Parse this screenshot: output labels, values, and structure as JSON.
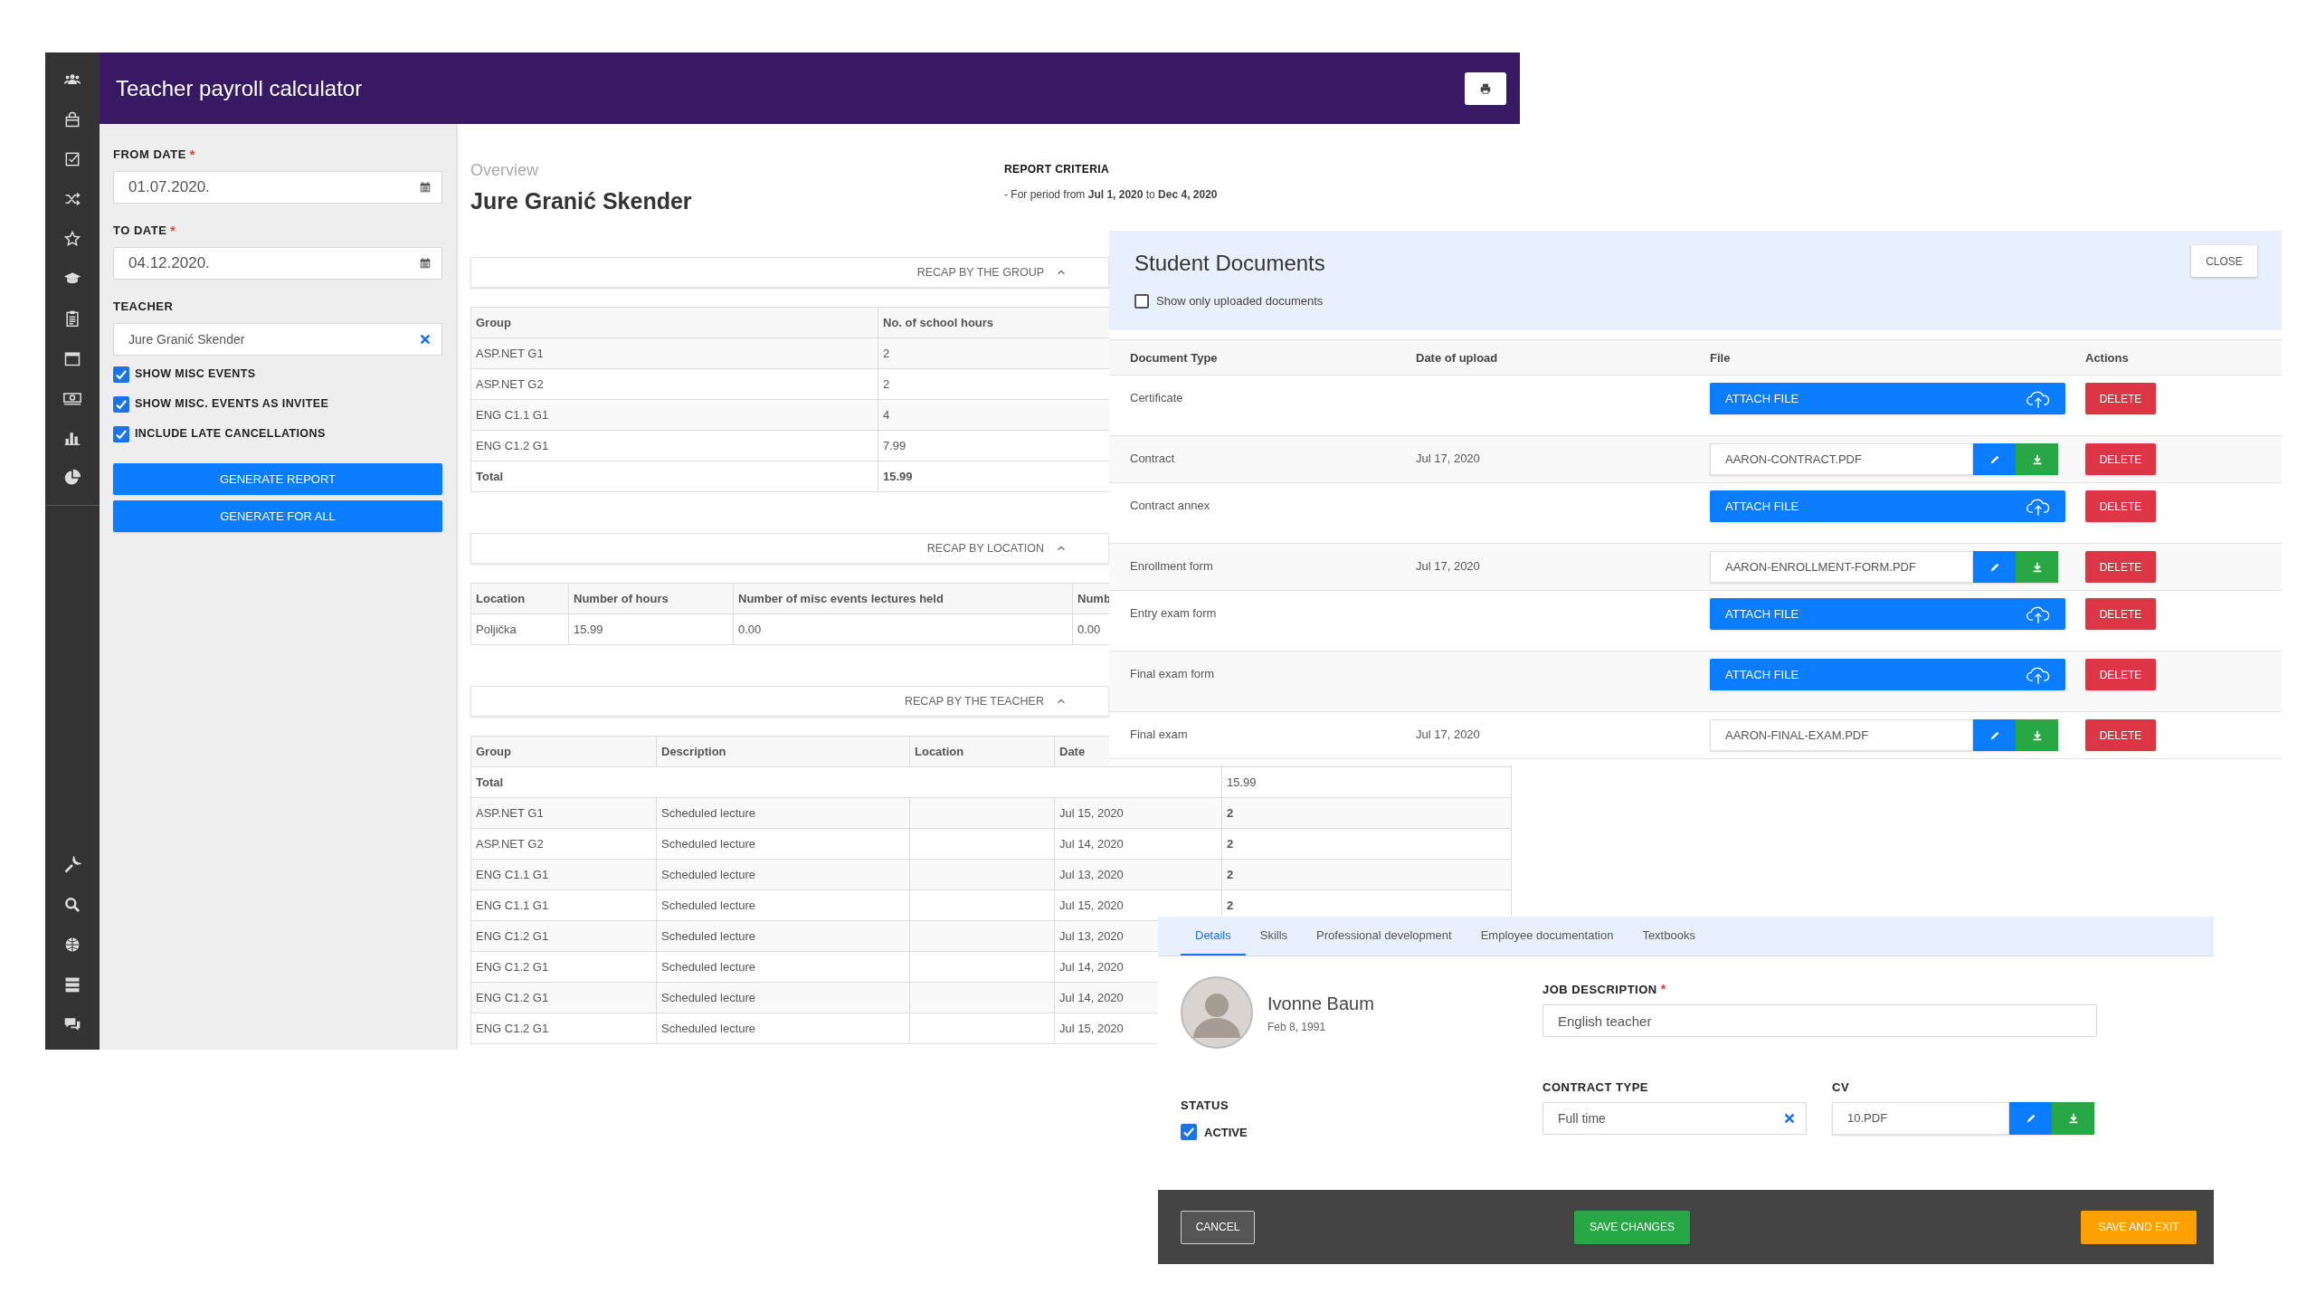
{
  "payroll_window": {
    "title": "Teacher payroll calculator",
    "form": {
      "from_date": {
        "label": "FROM DATE",
        "required_mark": "*",
        "value": "01.07.2020."
      },
      "to_date": {
        "label": "TO DATE",
        "required_mark": "*",
        "value": "04.12.2020."
      },
      "teacher": {
        "label": "TEACHER",
        "value": "Jure Granić Skender"
      },
      "options": [
        {
          "label": "SHOW MISC EVENTS",
          "checked": true
        },
        {
          "label": "SHOW MISC. EVENTS AS INVITEE",
          "checked": true
        },
        {
          "label": "INCLUDE LATE CANCELLATIONS",
          "checked": true
        }
      ],
      "buttons": [
        "GENERATE REPORT",
        "GENERATE FOR ALL"
      ]
    },
    "overview": {
      "subtitle": "Overview",
      "name": "Jure Granić Skender"
    },
    "report_criteria": {
      "title": "REPORT CRITERIA",
      "text": "- For period from **Jul 1, 2020** to **Dec 4, 2020**"
    },
    "sections": [
      {
        "kind": "group",
        "title": "RECAP BY THE GROUP",
        "expanded": true,
        "columns": [
          "Group",
          "No. of school hours"
        ],
        "rows": [
          [
            "ASP.NET G1",
            "2"
          ],
          [
            "ASP.NET G2",
            "2"
          ],
          [
            "ENG C1.1 G1",
            "4"
          ],
          [
            "ENG C1.2 G1",
            "7.99"
          ]
        ],
        "total": [
          "Total",
          "15.99"
        ]
      },
      {
        "kind": "location",
        "title": "RECAP BY LOCATION",
        "expanded": true,
        "columns": [
          "Location",
          "Number of hours",
          "Number of misc events lectures held",
          "Numb"
        ],
        "rows": [
          [
            "Poljička",
            "15.99",
            "0.00",
            "0.00"
          ]
        ]
      },
      {
        "kind": "teacher",
        "title": "RECAP BY THE TEACHER",
        "expanded": true,
        "columns": [
          "Group",
          "Description",
          "Location",
          "Date"
        ],
        "total": {
          "label": "Total",
          "column_5": "15.99"
        },
        "rows": [
          {
            "group": "ASP.NET G1",
            "description": "Scheduled lecture",
            "date": "Jul 15, 2020",
            "column_5": "2"
          },
          {
            "group": "ASP.NET G2",
            "description": "Scheduled lecture",
            "date": "Jul 14, 2020",
            "column_5": "2"
          },
          {
            "group": "ENG C1.1 G1",
            "description": "Scheduled lecture",
            "date": "Jul 13, 2020",
            "column_5": "2"
          },
          {
            "group": "ENG C1.1 G1",
            "description": "Scheduled lecture",
            "date": "Jul 15, 2020",
            "column_5": "2"
          },
          {
            "group": "ENG C1.2 G1",
            "description": "Scheduled lecture",
            "date": "Jul 13, 2020"
          },
          {
            "group": "ENG C1.2 G1",
            "description": "Scheduled lecture",
            "date": "Jul 14, 2020"
          },
          {
            "group": "ENG C1.2 G1",
            "description": "Scheduled lecture",
            "date": "Jul 14, 2020"
          },
          {
            "group": "ENG C1.2 G1",
            "description": "Scheduled lecture",
            "date": "Jul 15, 2020"
          }
        ]
      }
    ]
  },
  "documents_window": {
    "title": "Student Documents",
    "close": "CLOSE",
    "filter": {
      "label": "Show only uploaded documents",
      "checked": false
    },
    "columns": [
      "Document Type",
      "Date of upload",
      "File",
      "Actions"
    ],
    "rows": [
      {
        "kind": "attach",
        "type": "Certificate",
        "button": "ATTACH FILE",
        "delete": "DELETE"
      },
      {
        "kind": "file",
        "type": "Contract",
        "date": "Jul 17, 2020",
        "file": "AARON-CONTRACT.PDF",
        "delete": "DELETE"
      },
      {
        "kind": "attach",
        "type": "Contract annex",
        "button": "ATTACH FILE",
        "delete": "DELETE"
      },
      {
        "kind": "file",
        "type": "Enrollment form",
        "date": "Jul 17, 2020",
        "file": "AARON-ENROLLMENT-FORM.PDF",
        "delete": "DELETE"
      },
      {
        "kind": "attach",
        "type": "Entry exam form",
        "button": "ATTACH FILE",
        "delete": "DELETE"
      },
      {
        "kind": "attach",
        "type": "Final exam form",
        "button": "ATTACH FILE",
        "delete": "DELETE"
      },
      {
        "kind": "file",
        "type": "Final exam",
        "date": "Jul 17, 2020",
        "file": "AARON-FINAL-EXAM.PDF",
        "delete": "DELETE"
      }
    ]
  },
  "employee_window": {
    "tabs": [
      {
        "label": "Details",
        "selected": true
      },
      {
        "label": "Skills",
        "selected": false
      },
      {
        "label": "Professional development",
        "selected": false
      },
      {
        "label": "Employee documentation",
        "selected": false
      },
      {
        "label": "Textbooks",
        "selected": false
      }
    ],
    "profile": {
      "name": "Ivonne Baum",
      "birth_date": "Feb 8, 1991"
    },
    "job_description": {
      "label": "JOB DESCRIPTION",
      "required_mark": "*",
      "value": "English teacher"
    },
    "status": {
      "label": "STATUS",
      "option": {
        "label": "ACTIVE",
        "checked": true
      }
    },
    "contract_type": {
      "label": "CONTRACT TYPE",
      "value": "Full time"
    },
    "cv": {
      "label": "CV",
      "file": "10.PDF"
    },
    "footer": {
      "cancel": "CANCEL",
      "save": "SAVE CHANGES",
      "save_exit": "SAVE AND EXIT"
    }
  }
}
